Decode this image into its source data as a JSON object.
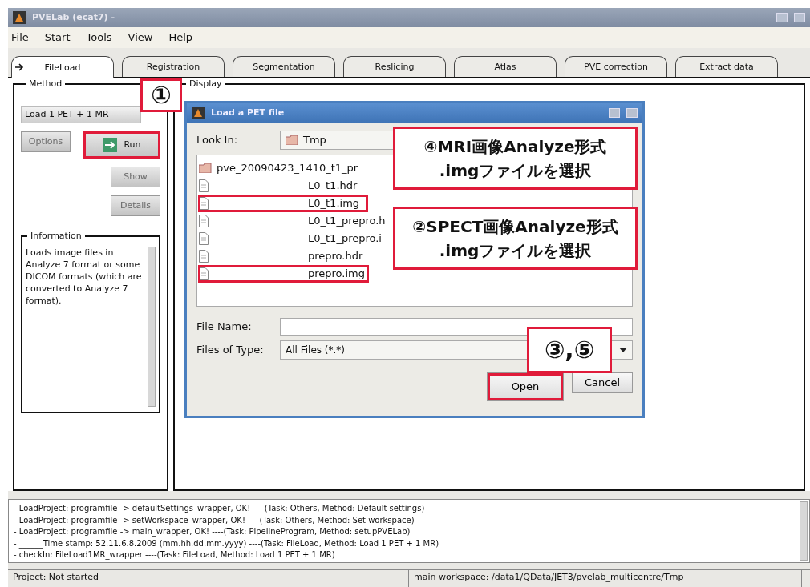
{
  "window": {
    "title": "PVELab (ecat7) -"
  },
  "menu": [
    "File",
    "Start",
    "Tools",
    "View",
    "Help"
  ],
  "tabs": [
    {
      "label": "FileLoad",
      "selected": true
    },
    {
      "label": "Registration",
      "selected": false
    },
    {
      "label": "Segmentation",
      "selected": false
    },
    {
      "label": "Reslicing",
      "selected": false
    },
    {
      "label": "Atlas",
      "selected": false
    },
    {
      "label": "PVE correction",
      "selected": false
    },
    {
      "label": "Extract data",
      "selected": false
    }
  ],
  "method": {
    "title": "Method",
    "dropdown": "Load 1 PET + 1 MR",
    "buttons": [
      {
        "label": "Options",
        "disabled": true,
        "marked": false
      },
      {
        "label": "Run",
        "disabled": false,
        "marked": true
      },
      {
        "label": "Show",
        "disabled": true,
        "marked": false
      },
      {
        "label": "Details",
        "disabled": true,
        "marked": false
      }
    ],
    "information": {
      "title": "Information",
      "text": "Loads image files in Analyze 7 format or some DICOM formats (which are converted to Analyze 7 format)."
    }
  },
  "display": {
    "title": "Display"
  },
  "dialog": {
    "title": "Load a PET file",
    "look_in_label": "Look In:",
    "look_in": "Tmp",
    "files": [
      {
        "name": "pve_20090423_1410_t1_pr",
        "kind": "folder",
        "marked": false
      },
      {
        "name": "L0_t1.hdr",
        "kind": "file",
        "marked": false
      },
      {
        "name": "L0_t1.img",
        "kind": "file",
        "marked": true
      },
      {
        "name": "L0_t1_prepro.h",
        "kind": "file",
        "marked": false
      },
      {
        "name": "L0_t1_prepro.i",
        "kind": "file",
        "marked": false
      },
      {
        "name": "prepro.hdr",
        "kind": "file",
        "marked": false
      },
      {
        "name": "prepro.img",
        "kind": "file",
        "marked": true
      }
    ],
    "file_name_label": "File Name:",
    "files_of_type_label": "Files of Type:",
    "files_of_type": "All Files (*.*)",
    "buttons": [
      {
        "label": "Open",
        "marked": true
      },
      {
        "label": "Cancel",
        "marked": false
      }
    ]
  },
  "callouts": [
    {
      "lines": [
        "①"
      ]
    },
    {
      "lines": [
        "④MRI画像Analyze形式",
        ".imgファイルを選択"
      ]
    },
    {
      "lines": [
        "②SPECT画像Analyze形式",
        ".imgファイルを選択"
      ]
    },
    {
      "lines": [
        "③,⑤"
      ]
    }
  ],
  "log": [
    "- LoadProject: programfile -> defaultSettings_wrapper, OK! ----(Task: Others, Method: Default settings)",
    "- LoadProject: programfile -> setWorkspace_wrapper, OK! ----(Task: Others, Method: Set workspace)",
    "- LoadProject: programfile -> main_wrapper, OK! ----(Task: PipelineProgram, Method: setupPVELab)",
    "- ______Time stamp: 52.11.6.8.2009 (mm.hh.dd.mm.yyyy) ----(Task: FileLoad, Method: Load 1 PET + 1 MR)",
    "- checkIn: FileLoad1MR_wrapper ----(Task: FileLoad, Method: Load 1 PET + 1 MR)"
  ],
  "status_bar": [
    "Project: Not started",
    "main workspace: /data1/QData/JET3/pvelab_multicentre/Tmp"
  ]
}
